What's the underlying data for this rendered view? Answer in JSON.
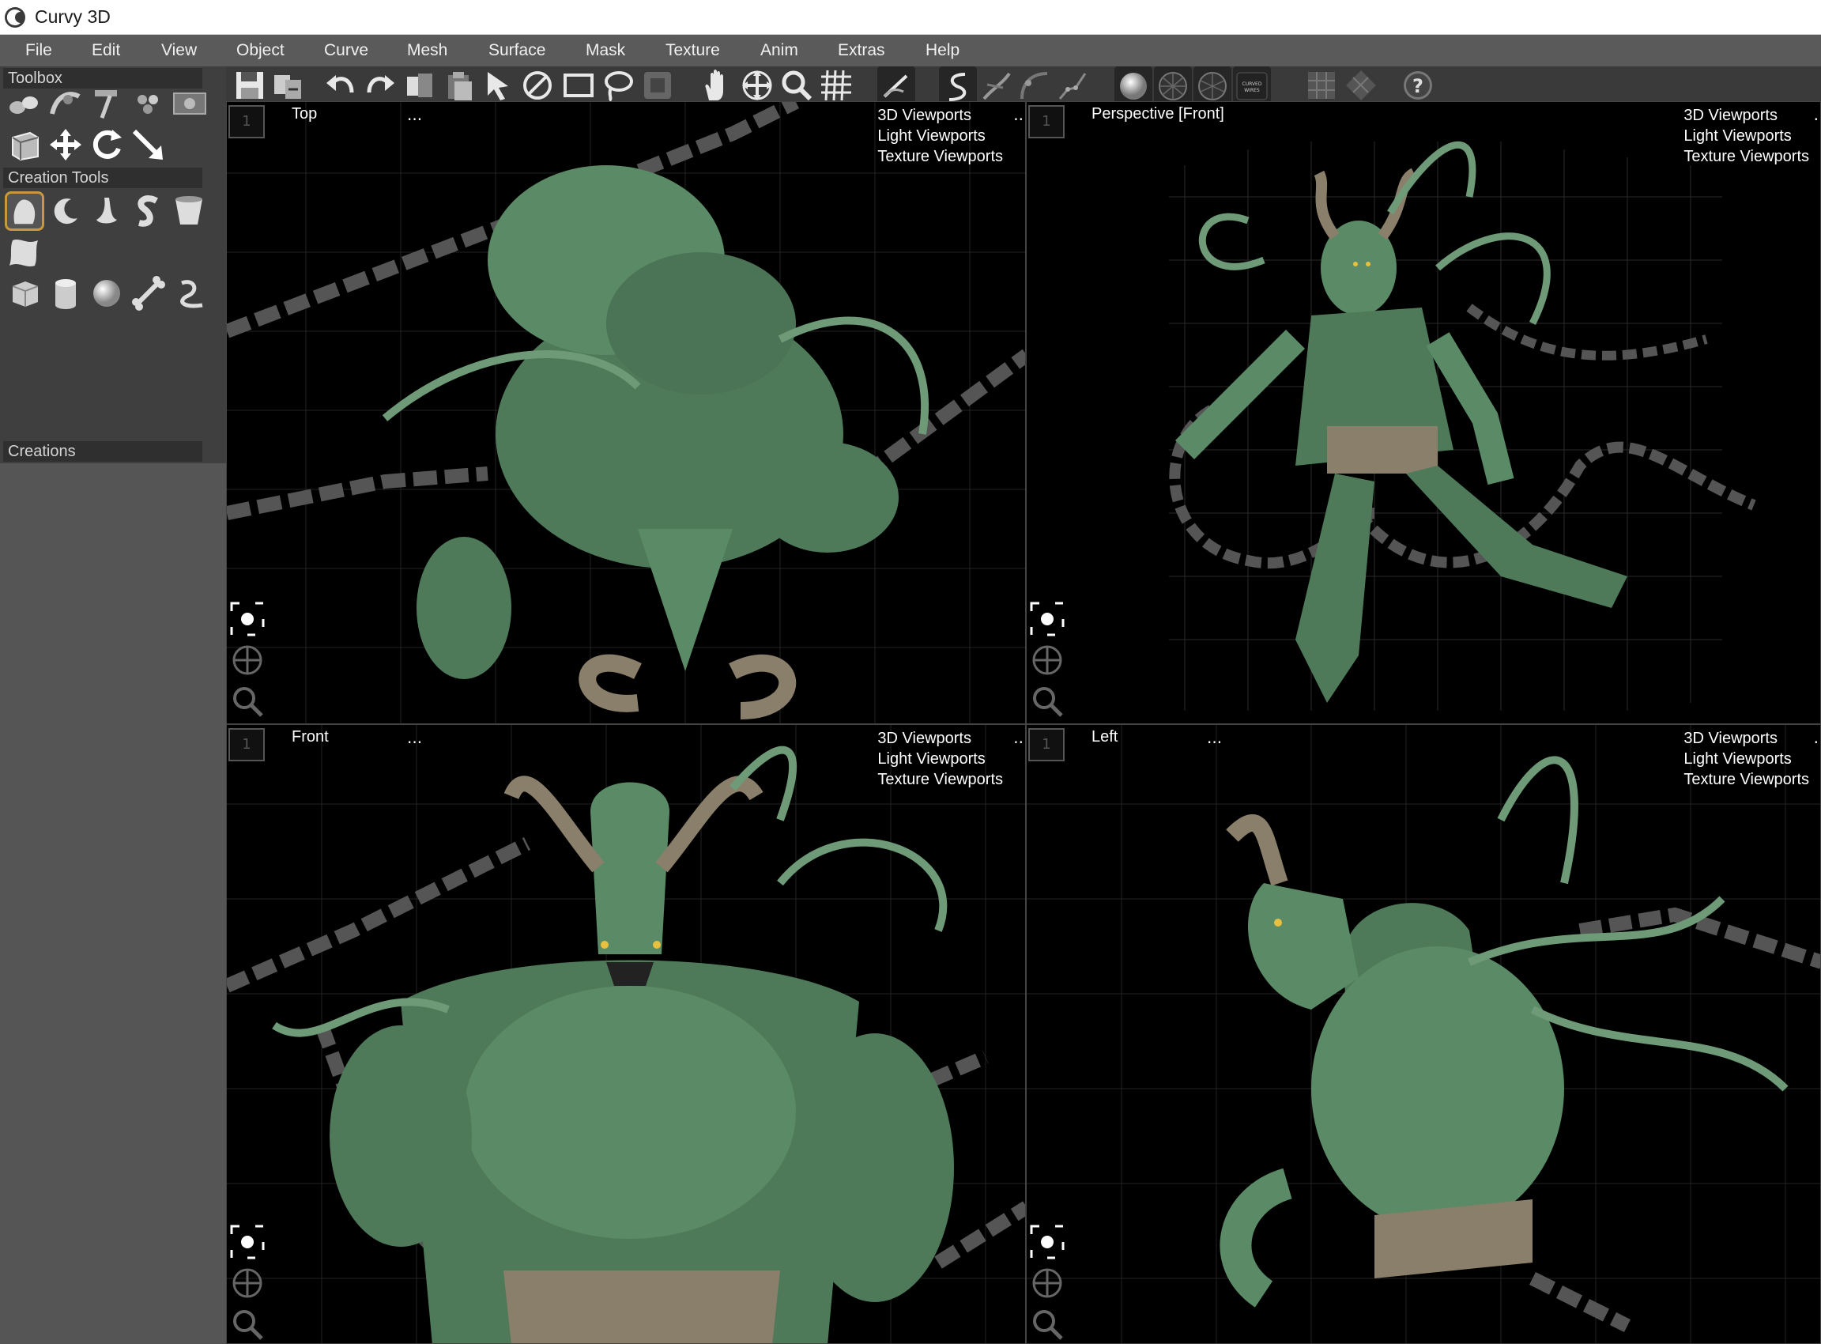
{
  "window": {
    "title": "Curvy 3D"
  },
  "menu": [
    "File",
    "Edit",
    "View",
    "Object",
    "Curve",
    "Mesh",
    "Surface",
    "Mask",
    "Texture",
    "Anim",
    "Extras",
    "Help"
  ],
  "panels": {
    "toolbox": "Toolbox",
    "creation_tools": "Creation Tools",
    "creations": "Creations"
  },
  "toolbar_icons": [
    "save-icon",
    "export-icon",
    "undo-icon",
    "redo-icon",
    "copy-icon",
    "paste-icon",
    "select-arrow-icon",
    "no-symbol-icon",
    "rectangle-select-icon",
    "lasso-select-icon",
    "frame-icon",
    "hand-pan-icon",
    "move-cross-icon",
    "zoom-magnifier-icon",
    "grid-hatch-icon",
    "slope-icon",
    "curve-s-icon",
    "curve-edit-icon",
    "curve-point-icon",
    "curve-spline-icon",
    "shaded-sphere-icon",
    "wire-sphere-icon",
    "wire-sphere-2-icon",
    "curved-wires-icon",
    "grid-square-icon",
    "grid-diamond-icon",
    "help-icon"
  ],
  "curved_wires_label": "CURVED WIRES",
  "viewports": [
    {
      "label": "Top",
      "dots": "...",
      "menu": [
        "3D Viewports",
        "Light Viewports",
        "Texture Viewports"
      ],
      "more": "..",
      "box": "1"
    },
    {
      "label": "Perspective [Front]",
      "dots": "",
      "menu": [
        "3D Viewports",
        "Light Viewports",
        "Texture Viewports"
      ],
      "more": ".",
      "box": "1"
    },
    {
      "label": "Front",
      "dots": "...",
      "menu": [
        "3D Viewports",
        "Light Viewports",
        "Texture Viewports"
      ],
      "more": "..",
      "box": "1"
    },
    {
      "label": "Left",
      "dots": "...",
      "menu": [
        "3D Viewports",
        "Light Viewports",
        "Texture Viewports"
      ],
      "more": ".",
      "box": "1"
    }
  ],
  "colors": {
    "skin": "#5b8a66",
    "horn": "#8a7f6a",
    "chain": "#6a6a6a",
    "accent": "#c8983c"
  }
}
